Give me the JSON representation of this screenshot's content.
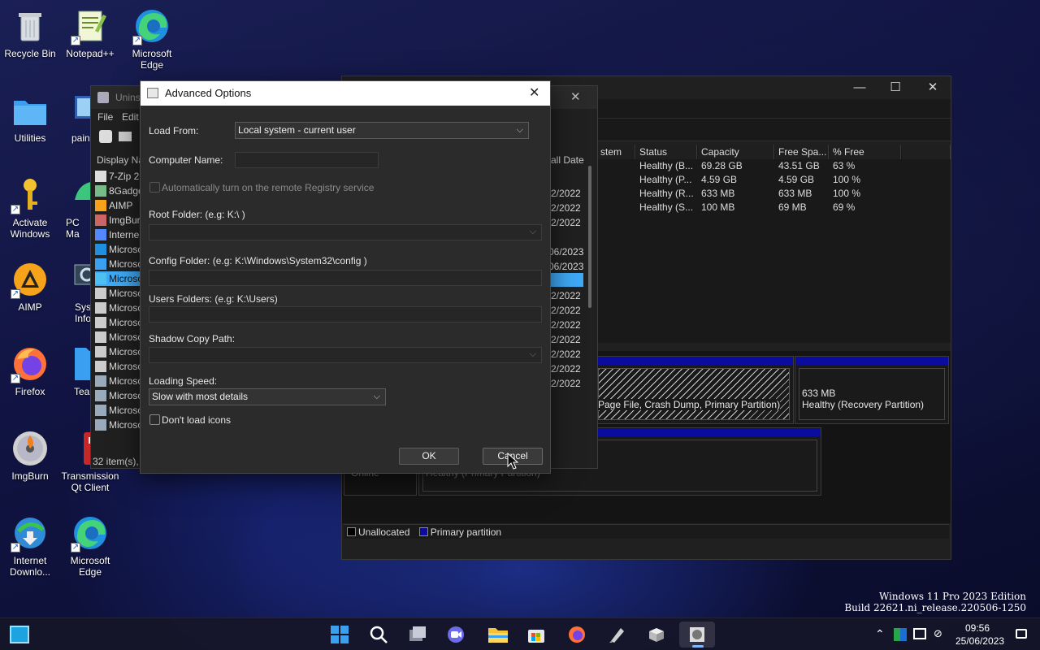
{
  "desktop": {
    "icons": [
      {
        "label": "Recycle Bin",
        "icon": "recycle-bin-icon"
      },
      {
        "label": "Notepad++",
        "icon": "notepad-plus-plus-icon"
      },
      {
        "label": "Microsoft Edge",
        "icon": "edge-icon"
      },
      {
        "label": "Utilities",
        "icon": "folder-icon"
      },
      {
        "label": "pain",
        "icon": "paint-icon"
      },
      {
        "label": "Activate Windows",
        "icon": "key-icon"
      },
      {
        "label": "PC Ma",
        "icon": "pc-manager-icon"
      },
      {
        "label": "AIMP",
        "icon": "aimp-icon"
      },
      {
        "label": "Syst Info",
        "icon": "system-info-icon"
      },
      {
        "label": "Firefox",
        "icon": "firefox-icon"
      },
      {
        "label": "Tea",
        "icon": "teams-icon"
      },
      {
        "label": "ImgBurn",
        "icon": "imgburn-icon"
      },
      {
        "label": "Transmission Qt Client",
        "icon": "transmission-icon"
      },
      {
        "label": "Internet Downlo...",
        "icon": "idm-icon"
      },
      {
        "label": "Microsoft Edge",
        "icon": "edge-icon"
      }
    ]
  },
  "disk_mgmt": {
    "columns": [
      "stem",
      "Status",
      "Capacity",
      "Free Spa...",
      "% Free"
    ],
    "rows": [
      {
        "status": "Healthy (B...",
        "capacity": "69.28 GB",
        "free": "43.51 GB",
        "pct": "63 %"
      },
      {
        "status": "Healthy (P...",
        "capacity": "4.59 GB",
        "free": "4.59 GB",
        "pct": "100 %"
      },
      {
        "status": "Healthy (R...",
        "capacity": "633 MB",
        "free": "633 MB",
        "pct": "100 %"
      },
      {
        "status": "Healthy (S...",
        "capacity": "100 MB",
        "free": "69 MB",
        "pct": "69 %"
      }
    ],
    "partition_c_desc": "Page File, Crash Dump, Primary Partition)",
    "recovery_size": "633 MB",
    "recovery_desc": "Healthy (Recovery Partition)",
    "disk1_status": "Online",
    "disk1_part_desc": "Healthy (Primary Partition)",
    "legend_unallocated": "Unallocated",
    "legend_primary": "Primary partition",
    "legend_colors": {
      "unallocated": "#000000",
      "primary": "#0b0b9e"
    }
  },
  "uninstaller": {
    "title": "Unins",
    "menu_file": "File",
    "menu_edit": "Edit",
    "col_display_name": "Display Na",
    "col_install_date": "all Date",
    "items": [
      "7-Zip 2",
      "8Gadge",
      "AIMP",
      "ImgBur",
      "Interne",
      "Microso",
      "Microso",
      "Microso",
      "Microso",
      "Microso",
      "Microso",
      "Microso",
      "Microso",
      "Microso",
      "Microso",
      "Microso",
      "Microso",
      "Microso"
    ],
    "dates": [
      "",
      "2/2022",
      "2/2022",
      "2/2022",
      "",
      "06/2023",
      "06/2023",
      "",
      "2/2022",
      "2/2022",
      "2/2022",
      "2/2022",
      "2/2022",
      "2/2022",
      "2/2022"
    ],
    "status": "32 item(s),"
  },
  "dialog": {
    "title": "Advanced Options",
    "load_from_label": "Load From:",
    "load_from_value": "Local system - current user",
    "computer_name_label": "Computer Name:",
    "remote_registry_label": "Automatically turn on the remote Registry service",
    "root_folder_label": "Root Folder: (e.g: K:\\ )",
    "config_folder_label": "Config Folder: (e.g: K:\\Windows\\System32\\config )",
    "users_folders_label": "Users Folders: (e.g: K:\\Users)",
    "shadow_copy_label": "Shadow Copy Path:",
    "loading_speed_label": "Loading Speed:",
    "loading_speed_value": "Slow with most details",
    "dont_load_icons_label": "Don't load icons",
    "ok_label": "OK",
    "cancel_label": "Cancel"
  },
  "watermark": {
    "line1": "Windows 11 Pro 2023 Edition",
    "line2": "Build 22621.ni_release.220506-1250"
  },
  "taskbar": {
    "time": "09:56",
    "date": "25/06/2023"
  }
}
